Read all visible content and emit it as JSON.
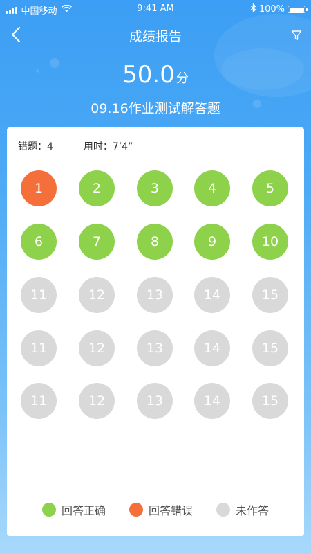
{
  "status_bar": {
    "carrier": "中国移动",
    "time": "9:41 AM",
    "battery": "100%",
    "icons": [
      "signal-icon",
      "wifi-icon",
      "bluetooth-icon",
      "battery-icon"
    ]
  },
  "nav": {
    "title": "成绩报告",
    "back_icon": "chevron-left-icon",
    "filter_icon": "filter-icon"
  },
  "score": {
    "value": "50.0",
    "unit": "分"
  },
  "assignment_title": "09.16作业测试解答题",
  "stats": {
    "wrong_label": "错题：",
    "wrong_count": "4",
    "time_label": "用时：",
    "time_value": "7’4”"
  },
  "questions": [
    {
      "label": "1",
      "status": "wrong"
    },
    {
      "label": "2",
      "status": "correct"
    },
    {
      "label": "3",
      "status": "correct"
    },
    {
      "label": "4",
      "status": "correct"
    },
    {
      "label": "5",
      "status": "correct"
    },
    {
      "label": "6",
      "status": "correct"
    },
    {
      "label": "7",
      "status": "correct"
    },
    {
      "label": "8",
      "status": "correct"
    },
    {
      "label": "9",
      "status": "correct"
    },
    {
      "label": "10",
      "status": "correct"
    },
    {
      "label": "11",
      "status": "unanswered"
    },
    {
      "label": "12",
      "status": "unanswered"
    },
    {
      "label": "13",
      "status": "unanswered"
    },
    {
      "label": "14",
      "status": "unanswered"
    },
    {
      "label": "15",
      "status": "unanswered"
    },
    {
      "label": "11",
      "status": "unanswered"
    },
    {
      "label": "12",
      "status": "unanswered"
    },
    {
      "label": "13",
      "status": "unanswered"
    },
    {
      "label": "14",
      "status": "unanswered"
    },
    {
      "label": "15",
      "status": "unanswered"
    },
    {
      "label": "11",
      "status": "unanswered"
    },
    {
      "label": "12",
      "status": "unanswered"
    },
    {
      "label": "13",
      "status": "unanswered"
    },
    {
      "label": "14",
      "status": "unanswered"
    },
    {
      "label": "15",
      "status": "unanswered"
    }
  ],
  "legend": {
    "correct": "回答正确",
    "wrong": "回答错误",
    "unanswered": "未作答"
  },
  "colors": {
    "correct": "#8ed14a",
    "wrong": "#f46f3a",
    "unanswered": "#d9d9d9",
    "header_blue": "#3c9ef4"
  }
}
